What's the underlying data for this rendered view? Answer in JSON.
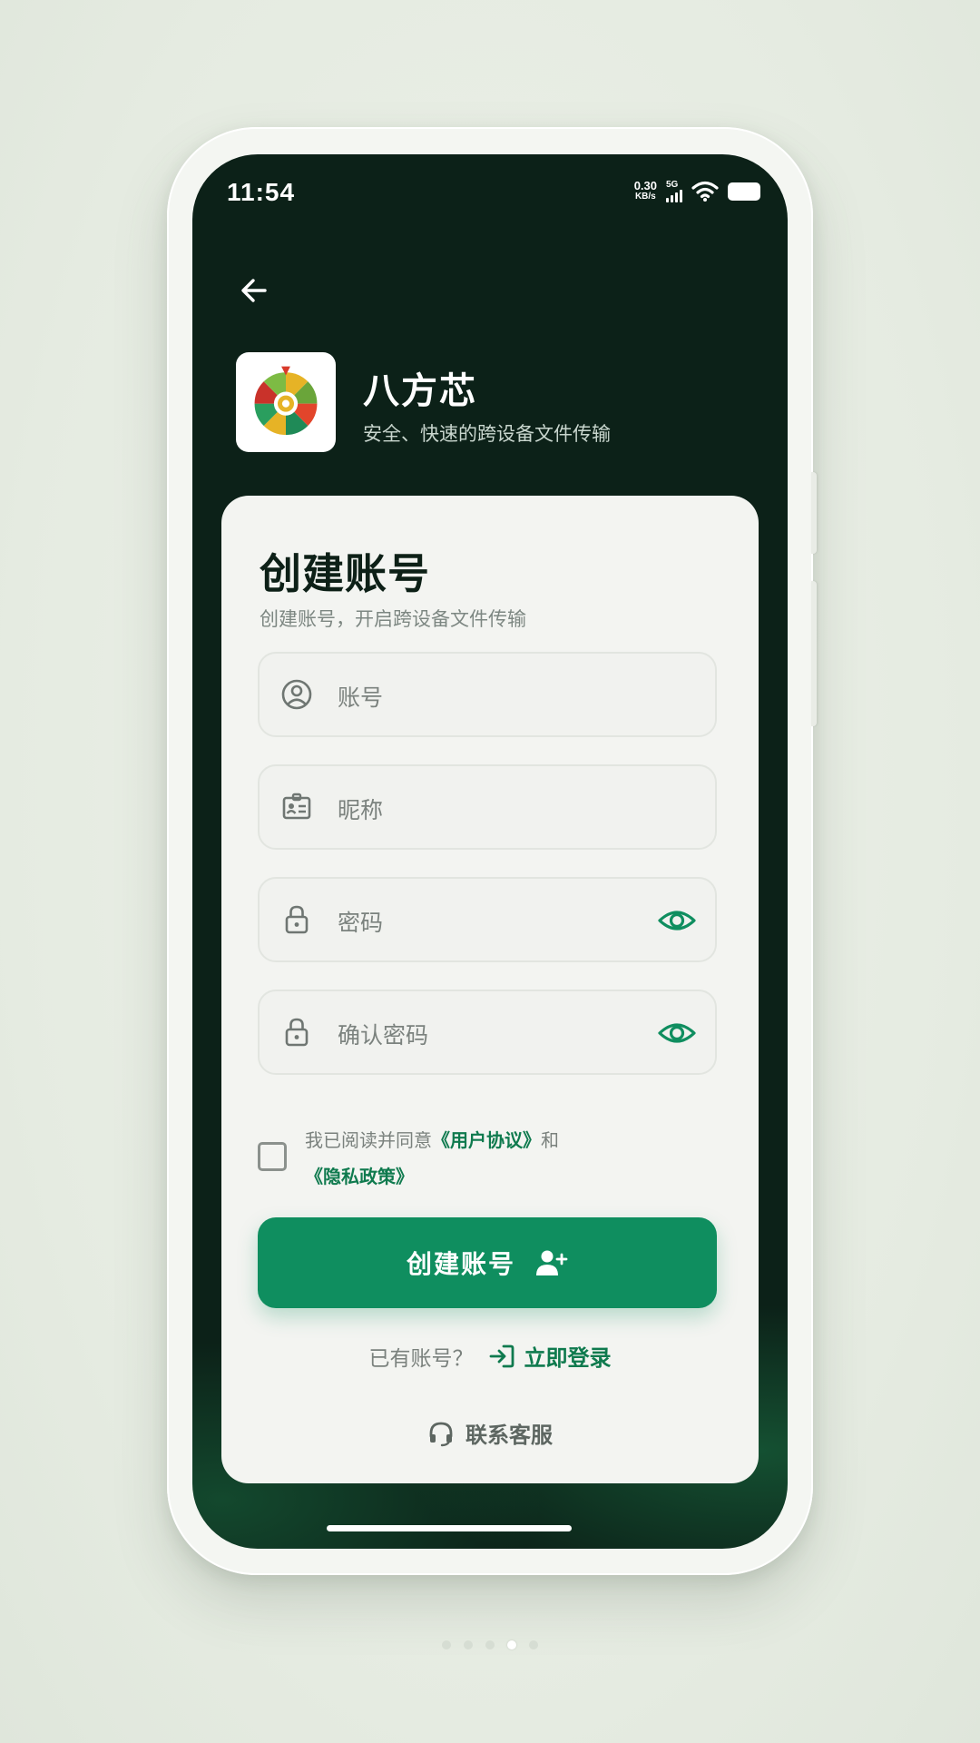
{
  "status_bar": {
    "time": "11:54",
    "net_speed_value": "0.30",
    "net_speed_unit": "KB/s",
    "network_type": "5G"
  },
  "header": {
    "back_icon": "arrow-left-icon",
    "app_name": "八方芯",
    "tagline": "安全、快速的跨设备文件传输"
  },
  "form": {
    "title": "创建账号",
    "subtitle": "创建账号，开启跨设备文件传输",
    "fields": [
      {
        "placeholder": "账号",
        "icon": "user-circle-icon"
      },
      {
        "placeholder": "昵称",
        "icon": "id-card-icon"
      },
      {
        "placeholder": "密码",
        "icon": "lock-icon"
      },
      {
        "placeholder": "确认密码",
        "icon": "lock-icon"
      }
    ],
    "agreement": {
      "prefix": "我已阅读并同意",
      "user_agreement": "《用户协议》",
      "conjunction": "和",
      "privacy_policy": "《隐私政策》"
    },
    "submit_label": "创建账号",
    "have_account": "已有账号？",
    "login_label": "立即登录",
    "support_label": "联系客服"
  },
  "colors": {
    "screen_bg": "#0c2118",
    "accent": "#0f8e5f",
    "link": "#0f7a4e",
    "card_bg": "#f3f4f1"
  },
  "pager": {
    "total": 5,
    "current": 4
  }
}
